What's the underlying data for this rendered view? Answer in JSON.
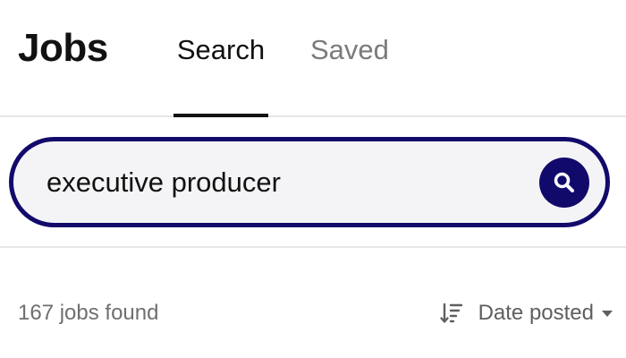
{
  "header": {
    "title": "Jobs",
    "tabs": [
      {
        "label": "Search",
        "active": true
      },
      {
        "label": "Saved",
        "active": false
      }
    ]
  },
  "search": {
    "value": "executive producer",
    "button_icon": "search-icon"
  },
  "results": {
    "count_text": "167 jobs found",
    "sort": {
      "icon": "sort-descending-icon",
      "selected": "Date posted",
      "dropdown_icon": "caret-down-icon"
    }
  },
  "colors": {
    "accent": "#120a6b",
    "input_background": "#f4f4f7",
    "muted_text": "#6f6f6f",
    "divider": "#e6e6e6"
  }
}
